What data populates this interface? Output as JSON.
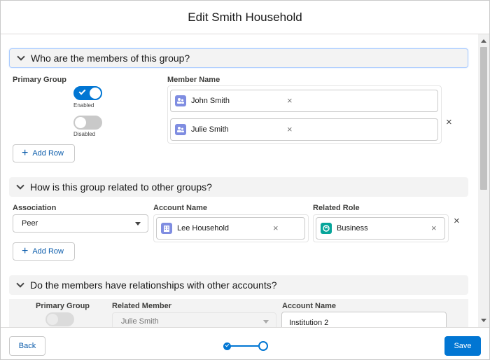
{
  "modal": {
    "title": "Edit Smith Household"
  },
  "members_section": {
    "title": "Who are the members of this group?",
    "col_primary": "Primary Group",
    "col_member": "Member Name",
    "rows": [
      {
        "toggle_label": "Enabled",
        "enabled": true,
        "member": "John Smith"
      },
      {
        "toggle_label": "Disabled",
        "enabled": false,
        "member": "Julie Smith"
      }
    ],
    "add_row": "Add Row"
  },
  "groups_section": {
    "title": "How is this group related to other groups?",
    "col_association": "Association",
    "col_account": "Account Name",
    "col_role": "Related Role",
    "association": "Peer",
    "account": "Lee Household",
    "role": "Business",
    "add_row": "Add Row"
  },
  "accounts_section": {
    "title": "Do the members have relationships with other accounts?",
    "col_primary": "Primary Group",
    "col_member": "Related Member",
    "col_account": "Account Name",
    "member": "Julie Smith",
    "account": "Institution 2"
  },
  "footer": {
    "back": "Back",
    "save": "Save"
  },
  "icons": {
    "remove": "×",
    "add": "+"
  },
  "colors": {
    "brand": "#0176d3",
    "contact_icon": "#7f8de1",
    "role_icon": "#06a59a"
  }
}
